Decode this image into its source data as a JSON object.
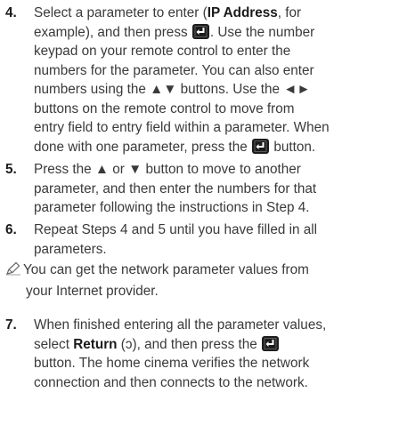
{
  "step4": {
    "number": "4.",
    "line1_a": "Select a parameter to enter (",
    "line1_bold": "IP Address",
    "line1_b": ", for",
    "line2_a": "example), and then press",
    "line2_b": ". Use the number",
    "line3": "keypad on your remote control to enter the",
    "line4": "numbers for the parameter. You can also enter",
    "line5": "numbers using the ▲▼ buttons. Use the ◄►",
    "line6": "buttons on the remote control to move from",
    "line7": "entry field to entry field within a parameter. When",
    "line8": "done with one parameter, press the",
    "line8_b": "button."
  },
  "step5": {
    "number": "5.",
    "line1": "Press the ▲ or ▼ button to move to another",
    "line2": "parameter, and then enter the numbers for that",
    "line3": "parameter following the instructions in Step 4."
  },
  "step6": {
    "number": "6.",
    "line1": "Repeat Steps 4 and 5 until you have filled in all",
    "line2": "parameters."
  },
  "note": {
    "icon": "pencil-note-icon",
    "line1": "You can get the network parameter values from",
    "line2": "your Internet provider."
  },
  "step7": {
    "number": "7.",
    "line1": "When finished entering all the parameter values,",
    "line2_a": "select",
    "line2_bold": "Return",
    "line2_b": "(ↄ), and then press the",
    "line3": "button. The home cinema verifies the network",
    "line4": "connection and then connects to the network."
  }
}
